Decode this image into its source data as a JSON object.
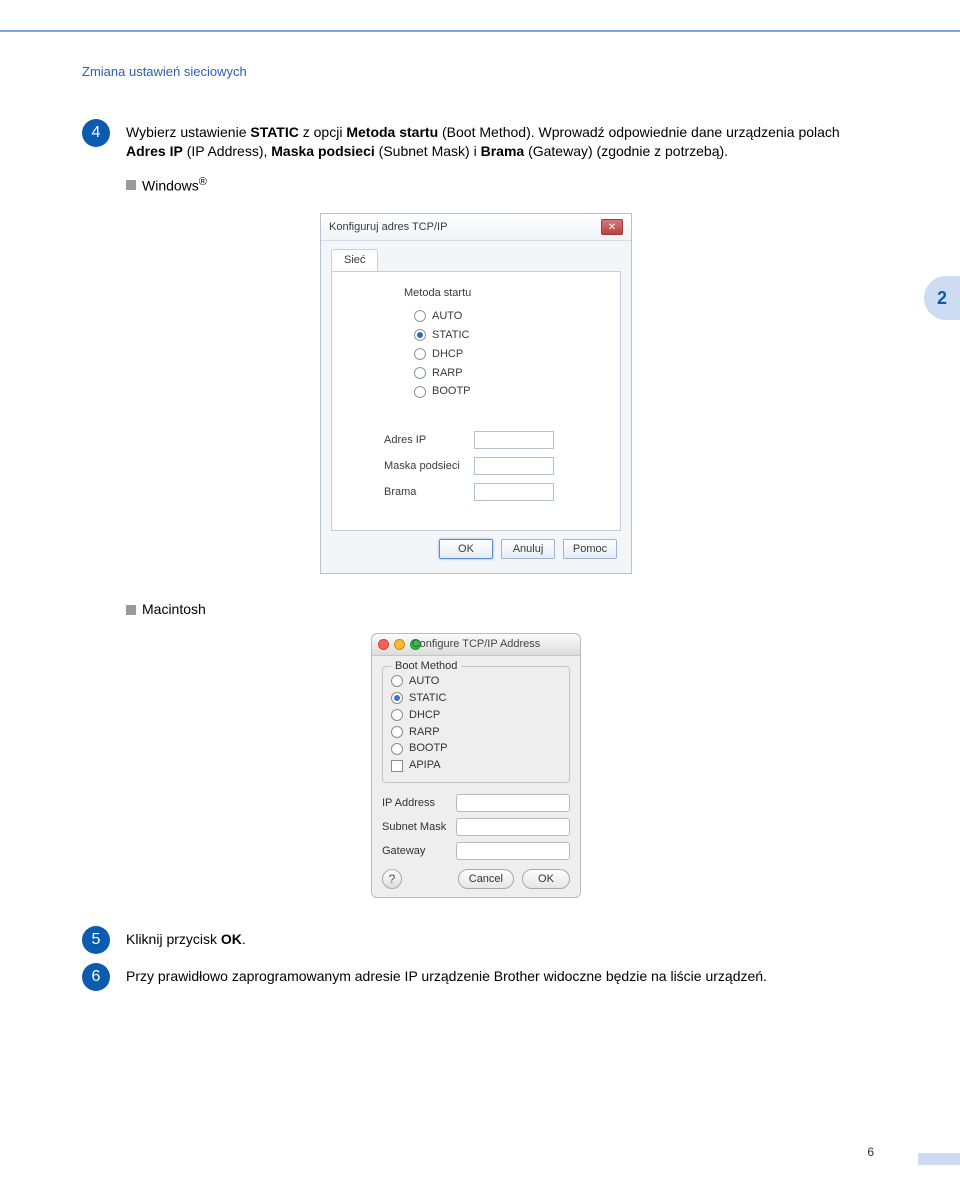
{
  "header": {
    "title": "Zmiana ustawień sieciowych"
  },
  "chapter_tab": "2",
  "page_number": "6",
  "steps": {
    "s4": {
      "num": "4",
      "prefix": "Wybierz ustawienie ",
      "bold1": "STATIC",
      "mid1": " z opcji ",
      "bold2": "Metoda startu",
      "tail1": " (Boot Method). Wprowadź odpowiednie dane urządzenia polach ",
      "bold3": "Adres IP",
      "mid3": " (IP Address), ",
      "bold4": "Maska podsieci",
      "mid4": " (Subnet Mask) i ",
      "bold5": "Brama",
      "tail5": " (Gateway) (zgodnie z potrzebą)."
    },
    "os_windows": "Windows",
    "reg": "®",
    "os_mac": "Macintosh",
    "s5": {
      "num": "5",
      "text_a": "Kliknij przycisk ",
      "bold": "OK",
      "text_b": "."
    },
    "s6": {
      "num": "6",
      "text": "Przy prawidłowo zaprogramowanym adresie IP urządzenie Brother widoczne będzie na liście urządzeń."
    }
  },
  "win": {
    "title": "Konfiguruj adres TCP/IP",
    "close": "✕",
    "tab": "Sieć",
    "boot_label": "Metoda startu",
    "options": {
      "auto": "AUTO",
      "static": "STATIC",
      "dhcp": "DHCP",
      "rarp": "RARP",
      "bootp": "BOOTP"
    },
    "ip_label": "Adres IP",
    "mask_label": "Maska podsieci",
    "gw_label": "Brama",
    "btn_ok": "OK",
    "btn_cancel": "Anuluj",
    "btn_help": "Pomoc"
  },
  "mac": {
    "title": "Configure TCP/IP Address",
    "legend": "Boot Method",
    "options": {
      "auto": "AUTO",
      "static": "STATIC",
      "dhcp": "DHCP",
      "rarp": "RARP",
      "bootp": "BOOTP",
      "apipa": "APIPA"
    },
    "ip_label": "IP Address",
    "mask_label": "Subnet Mask",
    "gw_label": "Gateway",
    "help": "?",
    "btn_cancel": "Cancel",
    "btn_ok": "OK"
  }
}
